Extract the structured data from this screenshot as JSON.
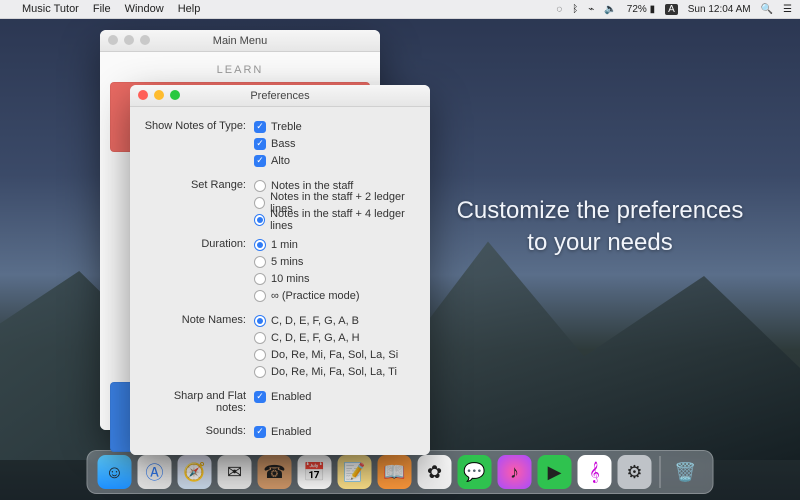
{
  "menubar": {
    "app_name": "Music Tutor",
    "items": [
      "File",
      "Window",
      "Help"
    ],
    "battery": "72%",
    "input_source": "A",
    "datetime": "Sun 12:04 AM"
  },
  "main_menu_window": {
    "title": "Main Menu",
    "learn_label": "LEARN"
  },
  "prefs_window": {
    "title": "Preferences",
    "groups": {
      "show_notes": {
        "label": "Show Notes of Type:",
        "treble": {
          "label": "Treble",
          "checked": true
        },
        "bass": {
          "label": "Bass",
          "checked": true
        },
        "alto": {
          "label": "Alto",
          "checked": true
        }
      },
      "set_range": {
        "label": "Set Range:",
        "opts": [
          {
            "label": "Notes in the staff",
            "selected": false
          },
          {
            "label": "Notes in the staff + 2 ledger lines",
            "selected": false
          },
          {
            "label": "Notes in the staff + 4 ledger lines",
            "selected": true
          }
        ]
      },
      "duration": {
        "label": "Duration:",
        "opts": [
          {
            "label": "1 min",
            "selected": true
          },
          {
            "label": "5 mins",
            "selected": false
          },
          {
            "label": "10 mins",
            "selected": false
          },
          {
            "label": "∞ (Practice mode)",
            "selected": false
          }
        ]
      },
      "note_names": {
        "label": "Note Names:",
        "opts": [
          {
            "label": "C, D, E, F, G, A, B",
            "selected": true
          },
          {
            "label": "C, D, E, F, G, A, H",
            "selected": false
          },
          {
            "label": "Do, Re, Mi, Fa, Sol, La, Si",
            "selected": false
          },
          {
            "label": "Do, Re, Mi, Fa, Sol, La, Ti",
            "selected": false
          }
        ]
      },
      "sharp_flat": {
        "label": "Sharp and Flat notes:",
        "value_label": "Enabled",
        "checked": true
      },
      "sounds": {
        "label": "Sounds:",
        "value_label": "Enabled",
        "checked": true
      }
    }
  },
  "hero": {
    "line1": "Customize the preferences",
    "line2": "to your needs"
  },
  "dock": {
    "apps": [
      "finder",
      "appstore",
      "safari",
      "mail",
      "contacts",
      "calendar",
      "notes",
      "ibooks",
      "photos",
      "messages",
      "itunes",
      "facetime",
      "music",
      "prefs"
    ],
    "trash": "trash"
  }
}
